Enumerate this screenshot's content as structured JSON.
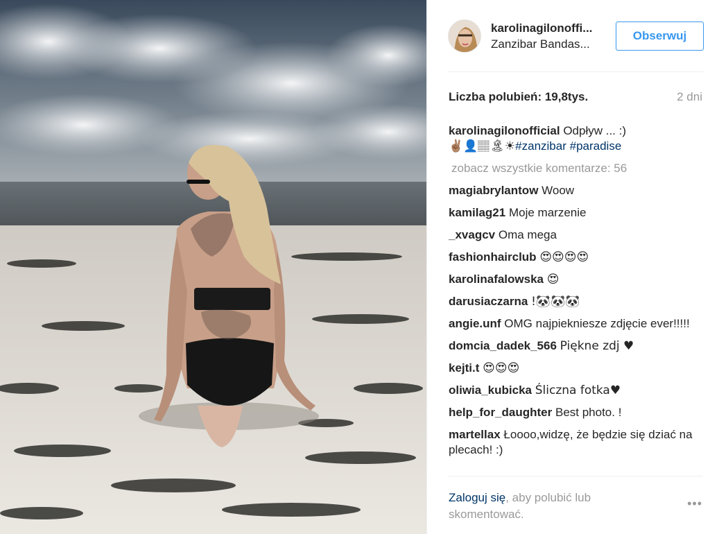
{
  "post": {
    "username": "karolinagilonoffi...",
    "location": "Zanzibar Bandas...",
    "follow_label": "Obserwuj",
    "likes": "Liczba polubień: 19,8tys.",
    "time": "2 dni"
  },
  "caption": {
    "username": "karolinagilonofficial",
    "text": "Odpływ ... :)",
    "emoji_line": "✌🏽👤🏽🏝☀",
    "hashtag_1": "#zanzibar",
    "hashtag_2": "#paradise"
  },
  "view_all_comments": "zobacz wszystkie komentarze: 56",
  "comments": [
    {
      "user": "magiabrylantow",
      "text": "Woow"
    },
    {
      "user": "kamilag21",
      "text": "Moje marzenie"
    },
    {
      "user": "_xvagcv",
      "text": "Oma mega"
    },
    {
      "user": "fashionhairclub",
      "text": "😍😍😍😍"
    },
    {
      "user": "karolinafalowska",
      "text": "😍"
    },
    {
      "user": "darusiaczarna",
      "text": "!🐼🐼🐼"
    },
    {
      "user": "angie.unf",
      "text": "OMG najpiekniesze zdjęcie ever!!!!!"
    },
    {
      "user": "domcia_dadek_566",
      "text": "Piękne zdj ♥"
    },
    {
      "user": "kejti.t",
      "text": "😍😍😍"
    },
    {
      "user": "oliwia_kubicka",
      "text": "Śliczna fotka♥"
    },
    {
      "user": "help_for_daughter",
      "text": "Best photo. !"
    },
    {
      "user": "martellax",
      "text": "Łoooo,widzę, że będzie się dziać na plecach! :)"
    }
  ],
  "footer": {
    "login_link": "Zaloguj się",
    "login_text": ", aby polubić lub skomentować.",
    "more_label": "•••"
  }
}
